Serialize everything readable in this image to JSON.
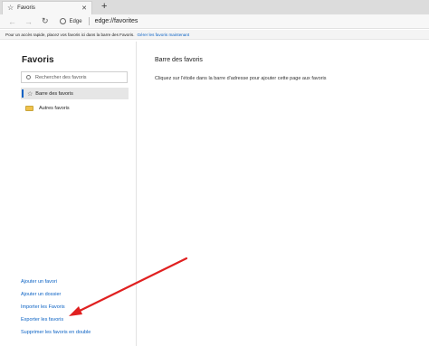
{
  "tab": {
    "title": "Favoris",
    "close": "✕",
    "new_tab": "+"
  },
  "address_bar": {
    "back": "←",
    "forward": "→",
    "reload": "↻",
    "browser_label": "Edge",
    "url": "edge://favorites"
  },
  "favorites_bar": {
    "message": "Pour un accès rapide, placez vos favoris ici dans la barre des Favoris.",
    "link": "Gérer les favoris maintenant"
  },
  "sidebar": {
    "title": "Favoris",
    "search_placeholder": "Rechercher des favoris",
    "folders": [
      {
        "label": "Barre des favoris",
        "icon": "star-icon",
        "selected": true
      },
      {
        "label": "Autres favoris",
        "icon": "folder-icon",
        "selected": false
      }
    ],
    "actions": [
      "Ajouter un favori",
      "Ajouter un dossier",
      "Importer les Favoris",
      "Exporter les favoris",
      "Supprimer les favoris en double"
    ]
  },
  "main": {
    "title": "Barre des favoris",
    "empty_text": "Cliquez sur l'étoile dans la barre d'adresse pour ajouter cette page aux favoris"
  },
  "colors": {
    "accent": "#0b62c4",
    "annotation_arrow": "#e02020",
    "folder": "#f0c14b"
  }
}
